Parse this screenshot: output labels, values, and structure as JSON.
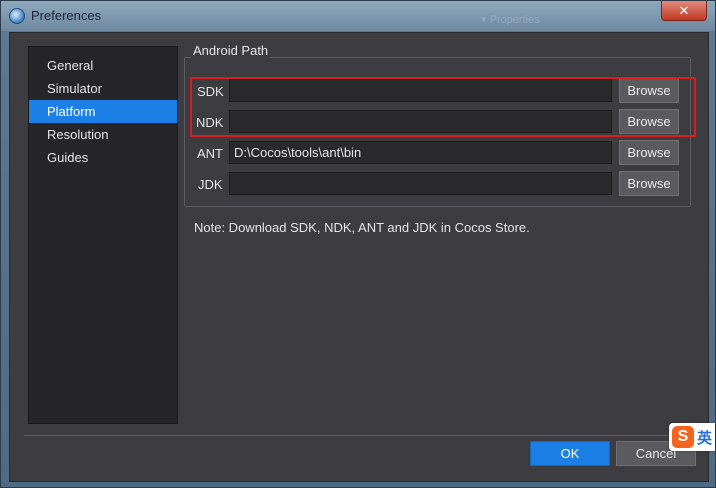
{
  "window": {
    "title": "Preferences",
    "close_glyph": "✕",
    "background_hint": "▾  Properties"
  },
  "sidebar": {
    "items": [
      {
        "label": "General"
      },
      {
        "label": "Simulator"
      },
      {
        "label": "Platform"
      },
      {
        "label": "Resolution"
      },
      {
        "label": "Guides"
      }
    ],
    "active_index": 2
  },
  "android_path": {
    "group_title": "Android Path",
    "rows": [
      {
        "label": "SDK",
        "value": "",
        "button": "Browse"
      },
      {
        "label": "NDK",
        "value": "",
        "button": "Browse"
      },
      {
        "label": "ANT",
        "value": "D:\\Cocos\\tools\\ant\\bin",
        "button": "Browse"
      },
      {
        "label": "JDK",
        "value": "",
        "button": "Browse"
      }
    ]
  },
  "note": "Note: Download SDK, NDK, ANT and JDK in Cocos Store.",
  "footer": {
    "ok_label": "OK",
    "cancel_label": "Cancel"
  },
  "ime": {
    "logo_letter": "S",
    "lang": "英"
  },
  "colors": {
    "accent": "#1c7fe6",
    "highlight_border": "#d42020",
    "panel_bg": "#3d3c41",
    "sidebar_bg": "#262629"
  }
}
